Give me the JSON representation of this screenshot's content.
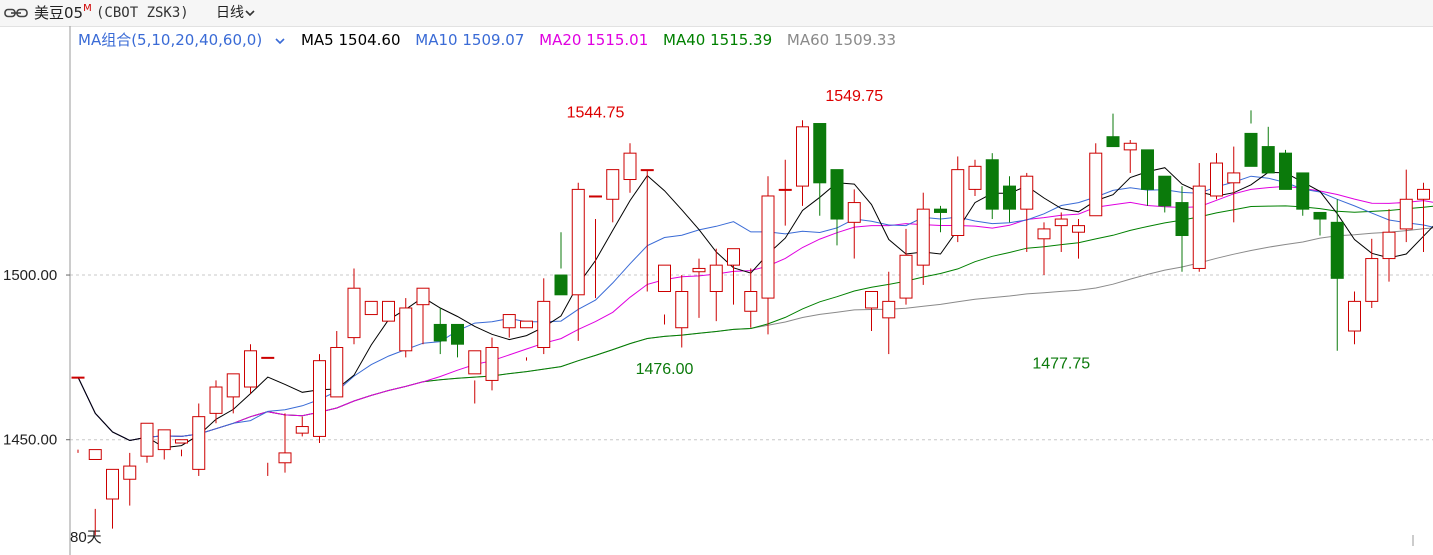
{
  "header": {
    "symbol": "美豆05",
    "symbol_flag": "M",
    "code": "(CBOT ZSK3)",
    "period": "日线"
  },
  "ma_legend": {
    "combo": "MA组合(5,10,20,40,60,0)",
    "items": [
      {
        "label": "MA5 1504.60",
        "color": "#000000"
      },
      {
        "label": "MA10 1509.07",
        "color": "#3a6bd6"
      },
      {
        "label": "MA20 1515.01",
        "color": "#e000e0"
      },
      {
        "label": "MA40 1515.39",
        "color": "#008000"
      },
      {
        "label": "MA60 1509.33",
        "color": "#8a8a8a"
      }
    ]
  },
  "colors": {
    "up": "#cc0000",
    "down": "#0b7a0b",
    "ma5": "#000000",
    "ma10": "#3a6bd6",
    "ma20": "#e000e0",
    "ma40": "#008000",
    "ma60": "#8a8a8a"
  },
  "chart_data": {
    "type": "candlestick",
    "ylim": [
      1415,
      1575
    ],
    "y_ticks": [
      1450,
      1500
    ],
    "y_tick_labels": [
      "1450.00",
      "1500.00"
    ],
    "annotations": [
      {
        "index": 30,
        "value": 1544.75,
        "label": "1544.75",
        "kind": "high"
      },
      {
        "index": 45,
        "value": 1549.75,
        "label": "1549.75",
        "kind": "high"
      },
      {
        "index": 34,
        "value": 1476.0,
        "label": "1476.00",
        "kind": "low"
      },
      {
        "index": 57,
        "value": 1477.75,
        "label": "1477.75",
        "kind": "low"
      }
    ],
    "period_label": "80天",
    "ohlc": [
      [
        1469,
        1469,
        1446,
        1447
      ],
      [
        1444,
        1447,
        1421,
        1429
      ],
      [
        1432,
        1441,
        1423,
        1440
      ],
      [
        1438,
        1442,
        1430,
        1446
      ],
      [
        1445,
        1455,
        1443,
        1447
      ],
      [
        1447,
        1453,
        1444,
        1450
      ],
      [
        1449,
        1450,
        1445,
        1447
      ],
      [
        1441,
        1457,
        1439,
        1461
      ],
      [
        1458,
        1466,
        1455,
        1468
      ],
      [
        1463,
        1470,
        1458,
        1468
      ],
      [
        1466,
        1477,
        1464,
        1479
      ],
      [
        1475,
        1475,
        1439,
        1443
      ],
      [
        1443,
        1446,
        1440,
        1458
      ],
      [
        1452,
        1454,
        1451,
        1457
      ],
      [
        1451,
        1474,
        1449,
        1476
      ],
      [
        1463,
        1478,
        1463,
        1483
      ],
      [
        1481,
        1496,
        1479,
        1502
      ],
      [
        1488,
        1492,
        1490,
        1491
      ],
      [
        1486,
        1492,
        1470,
        1470
      ],
      [
        1477,
        1490,
        1475,
        1493
      ],
      [
        1491,
        1496,
        1479,
        1492
      ],
      [
        1485,
        1480,
        1490,
        1476
      ],
      [
        1485,
        1479,
        1483,
        1475
      ],
      [
        1470,
        1477,
        1461,
        1468
      ],
      [
        1468,
        1478,
        1465,
        1481
      ],
      [
        1484,
        1488,
        1481,
        1484
      ],
      [
        1484,
        1486,
        1474,
        1475
      ],
      [
        1478,
        1492,
        1476,
        1499
      ],
      [
        1500,
        1494,
        1502,
        1513
      ],
      [
        1494,
        1526,
        1480,
        1528
      ],
      [
        1524,
        1524,
        1493,
        1517
      ],
      [
        1523,
        1532,
        1516,
        1532
      ],
      [
        1529,
        1537,
        1525,
        1540
      ],
      [
        1532,
        1532,
        1495,
        1532
      ],
      [
        1495,
        1503,
        1485,
        1488
      ],
      [
        1484,
        1495,
        1478,
        1500
      ],
      [
        1501,
        1502,
        1487,
        1505
      ],
      [
        1495,
        1503,
        1486,
        1508
      ],
      [
        1503,
        1508,
        1491,
        1506
      ],
      [
        1489,
        1495,
        1484,
        1502
      ],
      [
        1493,
        1524,
        1482,
        1530
      ],
      [
        1526,
        1526,
        1515,
        1535
      ],
      [
        1527,
        1545,
        1521,
        1547
      ],
      [
        1546,
        1528,
        1518,
        1532
      ],
      [
        1532,
        1517,
        1509,
        1517
      ],
      [
        1516,
        1522,
        1505,
        1526
      ],
      [
        1490,
        1495,
        1483,
        1492
      ],
      [
        1487,
        1492,
        1476,
        1501
      ],
      [
        1493,
        1506,
        1491,
        1514
      ],
      [
        1503,
        1520,
        1497,
        1525
      ],
      [
        1520,
        1519,
        1513,
        1521
      ],
      [
        1512,
        1532,
        1510,
        1536
      ],
      [
        1526,
        1533,
        1524,
        1535
      ],
      [
        1535,
        1520,
        1517,
        1537
      ],
      [
        1527,
        1520,
        1516,
        1530
      ],
      [
        1520,
        1530,
        1507,
        1531
      ],
      [
        1511,
        1514,
        1500,
        1516
      ],
      [
        1515,
        1517,
        1507,
        1519
      ],
      [
        1513,
        1515,
        1505,
        1517
      ],
      [
        1518,
        1537,
        1520,
        1540
      ],
      [
        1542,
        1539,
        1542,
        1549
      ],
      [
        1538,
        1540,
        1531,
        1541
      ],
      [
        1538,
        1526,
        1521,
        1538
      ],
      [
        1530,
        1521,
        1519,
        1530
      ],
      [
        1522,
        1512,
        1501,
        1527
      ],
      [
        1502,
        1527,
        1501,
        1534
      ],
      [
        1524,
        1534,
        1523,
        1537
      ],
      [
        1528,
        1531,
        1516,
        1539
      ],
      [
        1543,
        1533,
        1546,
        1550
      ],
      [
        1539,
        1531,
        1533,
        1545
      ],
      [
        1537,
        1526,
        1535,
        1538
      ],
      [
        1531,
        1520,
        1518,
        1529
      ],
      [
        1519,
        1517,
        1512,
        1518
      ],
      [
        1516,
        1499,
        1477,
        1523
      ],
      [
        1483,
        1492,
        1479,
        1495
      ],
      [
        1492,
        1505,
        1490,
        1511
      ],
      [
        1505,
        1513,
        1498,
        1520
      ],
      [
        1514,
        1523,
        1510,
        1532
      ],
      [
        1523,
        1526,
        1507,
        1528
      ],
      [
        1520,
        1519,
        1516,
        1531
      ]
    ]
  }
}
